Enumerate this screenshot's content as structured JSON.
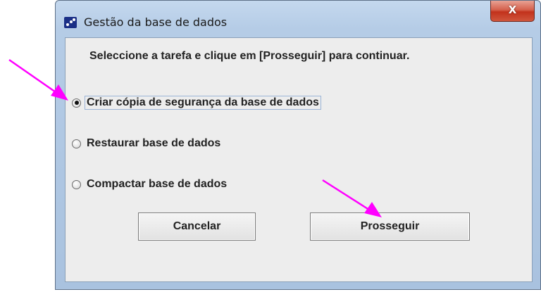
{
  "window": {
    "title": "Gestão da base de dados",
    "close_label": "X"
  },
  "instruction": "Seleccione a tarefa e clique em [Prosseguir] para continuar.",
  "options": [
    {
      "label": "Criar cópia de segurança da base de dados",
      "selected": true
    },
    {
      "label": "Restaurar base de dados",
      "selected": false
    },
    {
      "label": "Compactar base de dados",
      "selected": false
    }
  ],
  "buttons": {
    "cancel": "Cancelar",
    "proceed": "Prosseguir"
  },
  "colors": {
    "annotation_arrow": "#ff00ff"
  }
}
